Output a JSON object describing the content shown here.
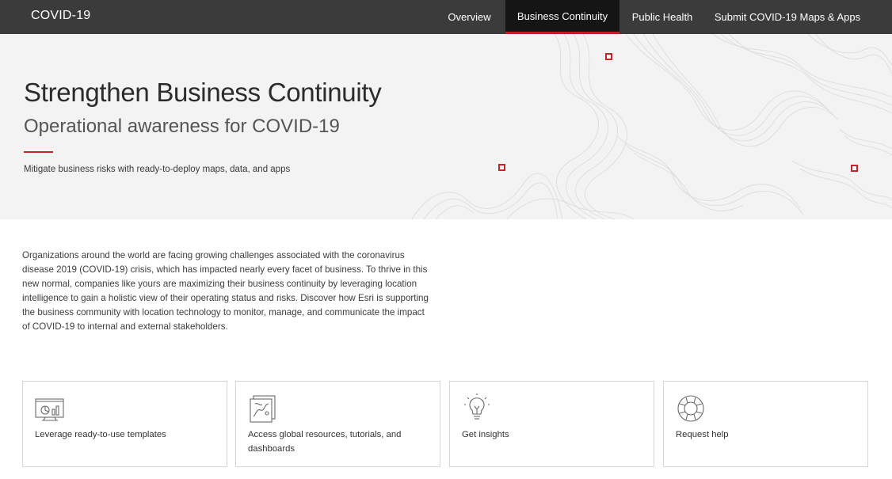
{
  "brand": "COVID-19",
  "nav": [
    {
      "label": "Overview"
    },
    {
      "label": "Business Continuity",
      "active": true
    },
    {
      "label": "Public Health"
    },
    {
      "label": "Submit COVID-19 Maps & Apps"
    }
  ],
  "hero": {
    "title": "Strengthen Business Continuity",
    "subtitle": "Operational awareness for COVID-19",
    "tagline": "Mitigate business risks with ready-to-deploy maps, data, and apps"
  },
  "intro": "Organizations around the world are facing growing challenges associated with the coronavirus disease 2019 (COVID-19) crisis, which has impacted nearly every facet of business. To thrive in this new normal, companies like yours are maximizing their business continuity by leveraging location intelligence to gain a holistic view of their operating status and risks. Discover how Esri is supporting the business community with location technology to monitor, manage, and communicate the impact of COVID-19 to internal and external stakeholders.",
  "cards": [
    {
      "label": "Leverage ready-to-use templates",
      "icon": "dashboard-monitor-icon"
    },
    {
      "label": "Access global resources, tutorials, and dashboards",
      "icon": "map-document-icon"
    },
    {
      "label": "Get insights",
      "icon": "lightbulb-icon"
    },
    {
      "label": "Request help",
      "icon": "lifebuoy-icon"
    }
  ],
  "colors": {
    "nav_bg": "#3b3b3b",
    "nav_active_bg": "#151515",
    "accent_red": "#c4252a",
    "hero_bg": "#f3f3f3"
  }
}
